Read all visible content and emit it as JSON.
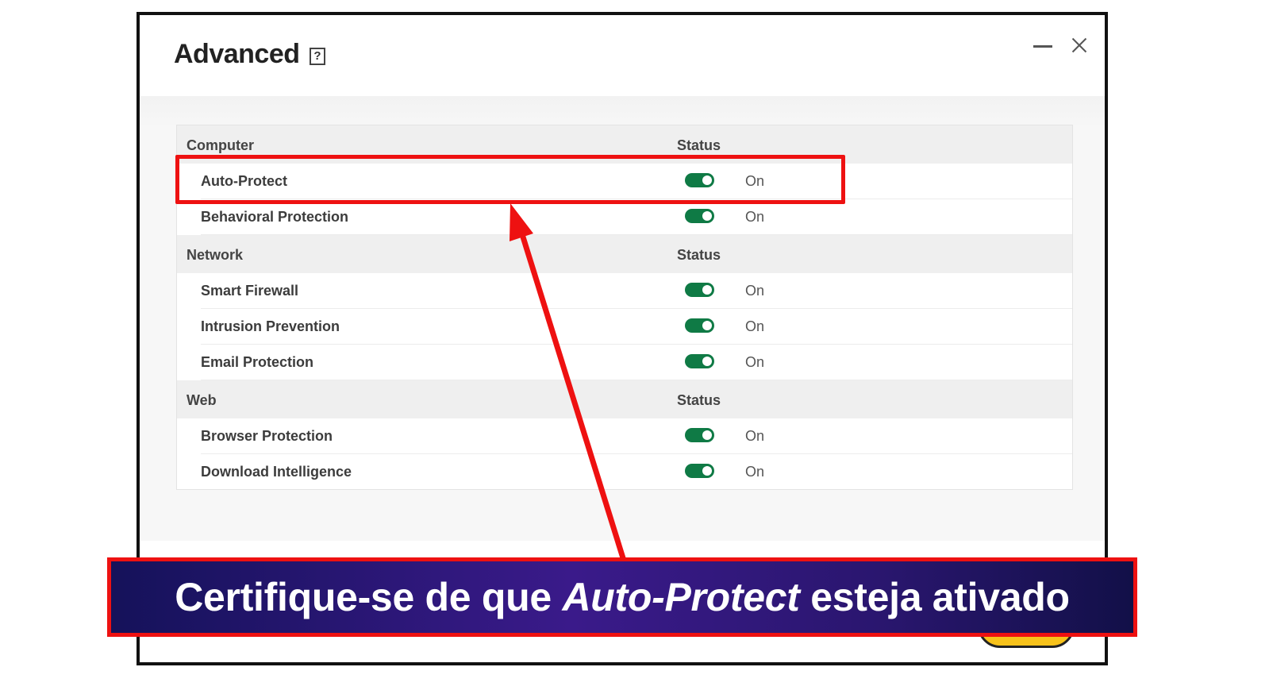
{
  "window": {
    "title": "Advanced",
    "help_label": "?"
  },
  "sections": [
    {
      "name": "Computer",
      "status_header": "Status",
      "rows": [
        {
          "label": "Auto-Protect",
          "state": "On"
        },
        {
          "label": "Behavioral Protection",
          "state": "On"
        }
      ]
    },
    {
      "name": "Network",
      "status_header": "Status",
      "rows": [
        {
          "label": "Smart Firewall",
          "state": "On"
        },
        {
          "label": "Intrusion Prevention",
          "state": "On"
        },
        {
          "label": "Email Protection",
          "state": "On"
        }
      ]
    },
    {
      "name": "Web",
      "status_header": "Status",
      "rows": [
        {
          "label": "Browser Protection",
          "state": "On"
        },
        {
          "label": "Download Intelligence",
          "state": "On"
        }
      ]
    }
  ],
  "banner": {
    "prefix": "Certifique-se de que ",
    "emphasis": "Auto-Protect",
    "suffix": " esteja ativado"
  },
  "colors": {
    "toggle_on": "#0f7a45",
    "annotation_red": "#ee1111",
    "banner_purple": "#3a1a8a"
  }
}
